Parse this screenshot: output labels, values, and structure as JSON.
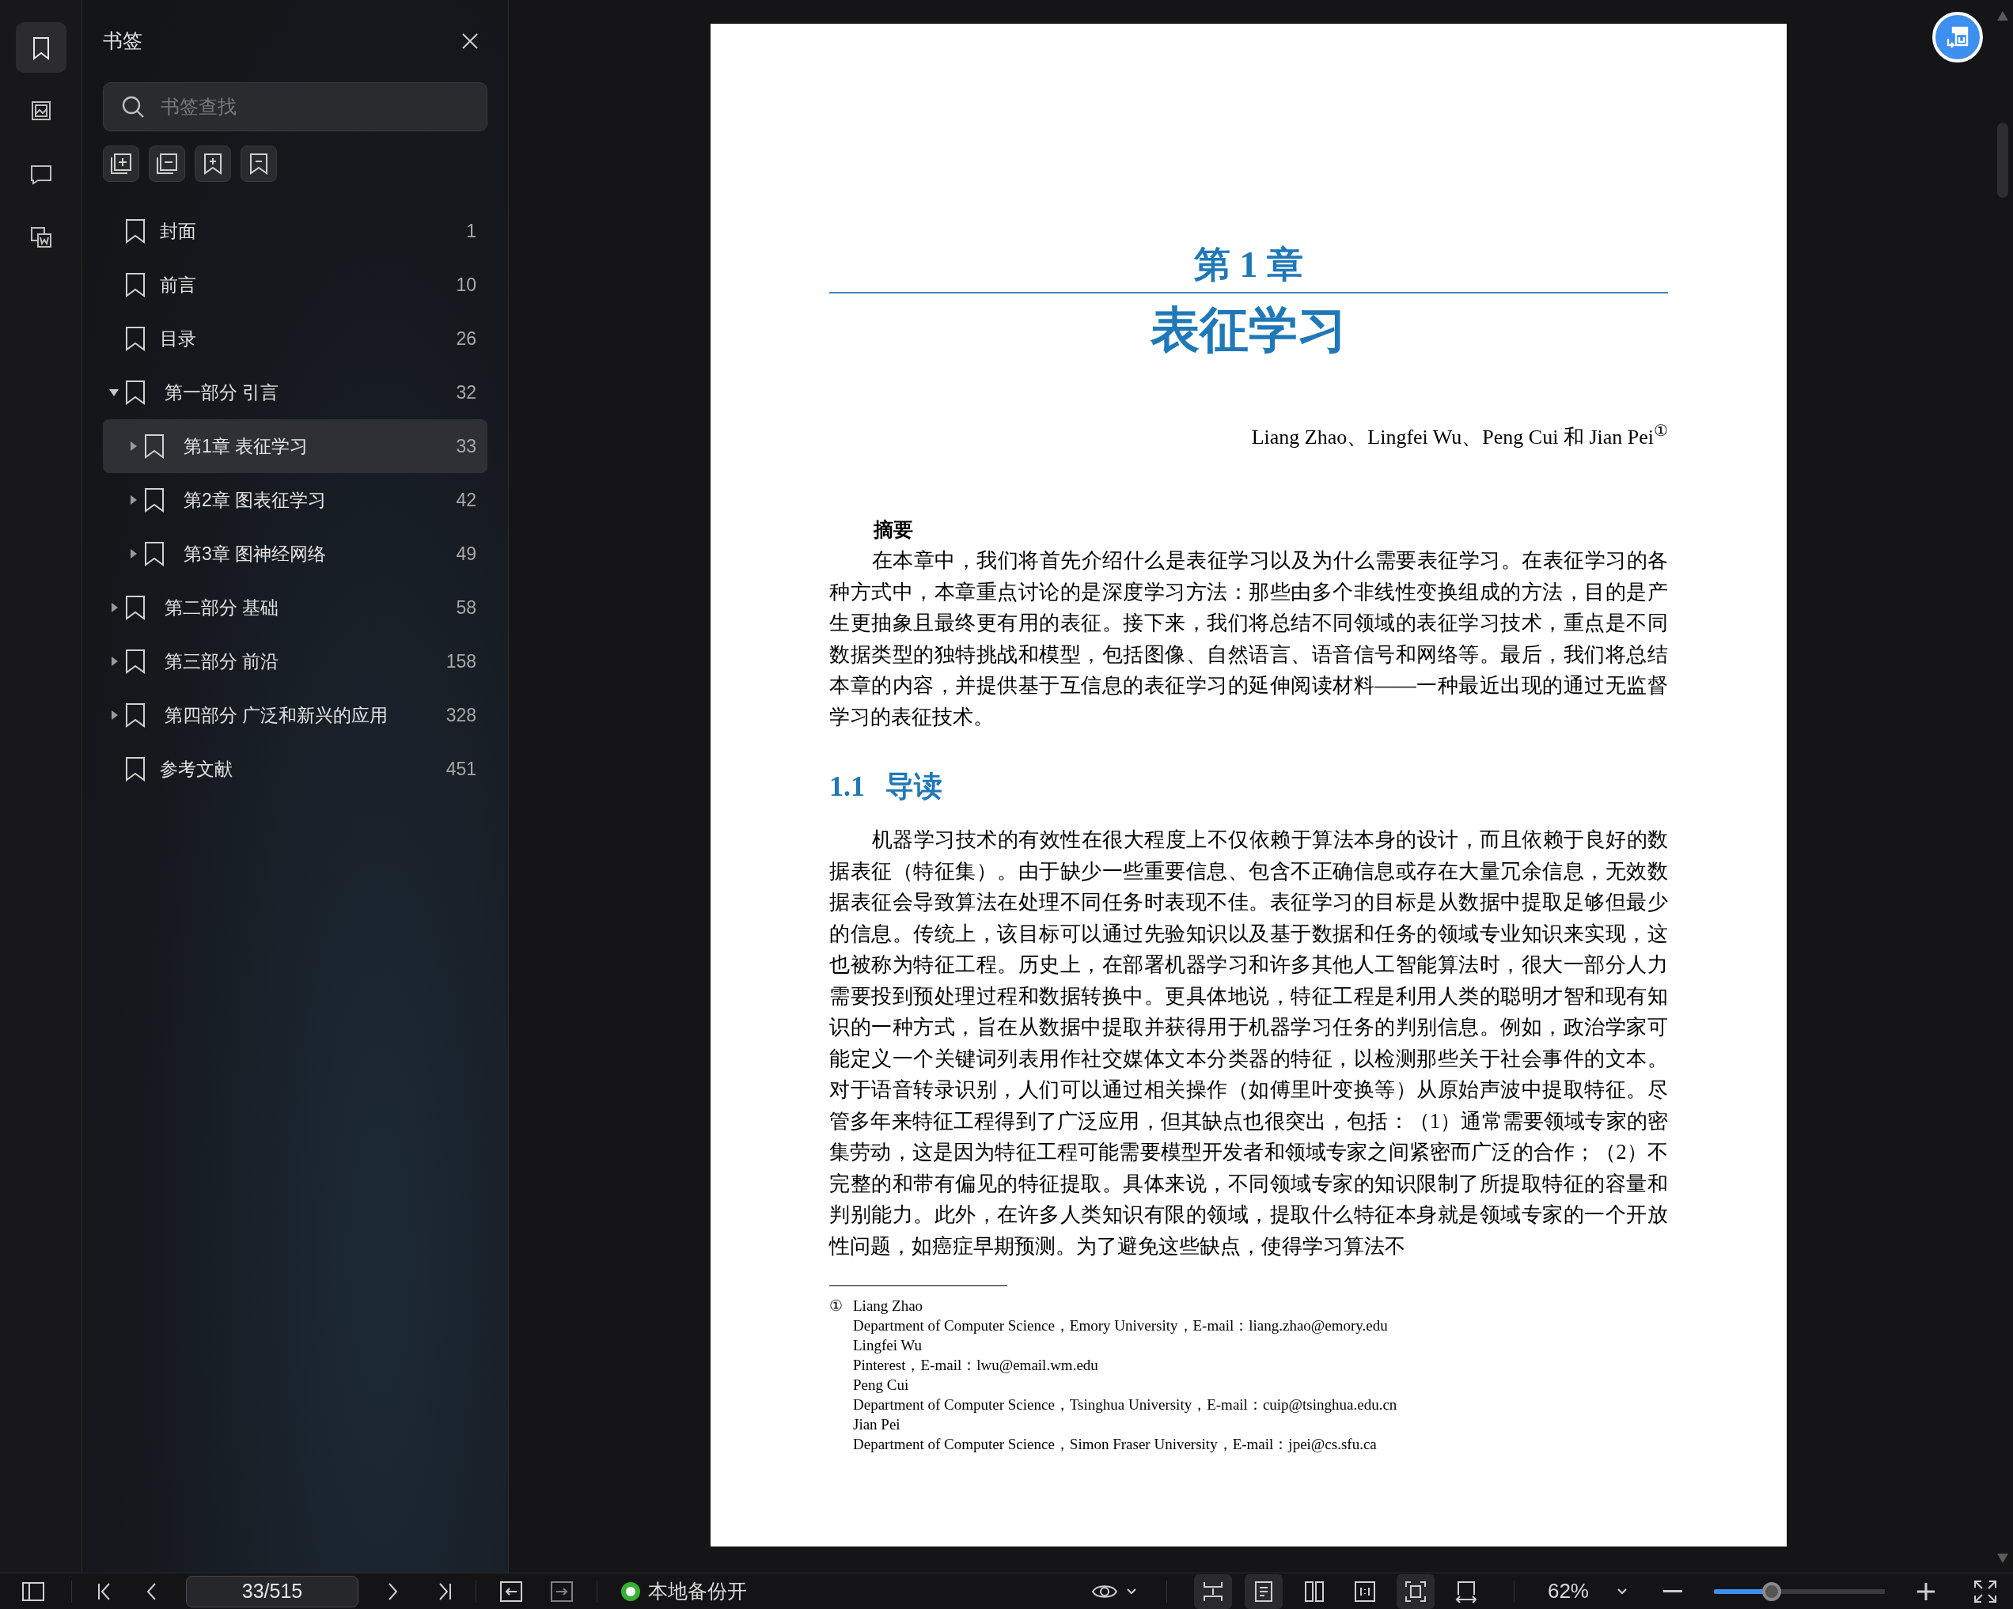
{
  "rail": [
    {
      "selected": true
    },
    {
      "selected": false
    },
    {
      "selected": false
    },
    {
      "selected": false
    }
  ],
  "sidebar": {
    "title": "书签",
    "search": {
      "placeholder": "书签查找"
    },
    "bookmarks": [
      {
        "kind": "leaf",
        "label": "封面",
        "page": "1",
        "selected": false
      },
      {
        "kind": "leaf",
        "label": "前言",
        "page": "10",
        "selected": false
      },
      {
        "kind": "leaf",
        "label": "目录",
        "page": "26",
        "selected": false
      },
      {
        "kind": "group",
        "label": "第一部分 引言",
        "page": "32",
        "selected": false,
        "expanded": true,
        "children": [
          {
            "kind": "group",
            "label": "第1章 表征学习",
            "page": "33",
            "selected": true,
            "expanded": false
          },
          {
            "kind": "group",
            "label": "第2章 图表征学习",
            "page": "42",
            "selected": false,
            "expanded": false
          },
          {
            "kind": "group",
            "label": "第3章 图神经网络",
            "page": "49",
            "selected": false,
            "expanded": false
          }
        ]
      },
      {
        "kind": "group",
        "label": "第二部分 基础",
        "page": "58",
        "selected": false,
        "expanded": false
      },
      {
        "kind": "group",
        "label": "第三部分 前沿",
        "page": "158",
        "selected": false,
        "expanded": false
      },
      {
        "kind": "group",
        "label": "第四部分 广泛和新兴的应用",
        "page": "328",
        "selected": false,
        "expanded": false
      },
      {
        "kind": "leaf",
        "label": "参考文献",
        "page": "451",
        "selected": false
      }
    ]
  },
  "document_page": {
    "chapter_number": "第 1 章",
    "chapter_title": "表征学习",
    "authors": "Liang Zhao、Lingfei Wu、Peng Cui 和 Jian Pei$^{①}$",
    "abstract_heading": "摘要",
    "abstract": "在本章中，我们将首先介绍什么是表征学习以及为什么需要表征学习。在表征学习的各种方式中，本章重点讨论的是深度学习方法：那些由多个非线性变换组成的方法，目的是产生更抽象且最终更有用的表征。接下来，我们将总结不同领域的表征学习技术，重点是不同数据类型的独特挑战和模型，包括图像、自然语言、语音信号和网络等。最后，我们将总结本章的内容，并提供基于互信息的表征学习的延伸阅读材料——一种最近出现的通过无监督学习的表征技术。",
    "section_number": "1.1",
    "section_title": "导读",
    "paragraph": "机器学习技术的有效性在很大程度上不仅依赖于算法本身的设计，而且依赖于良好的数据表征（特征集）。由于缺少一些重要信息、包含不正确信息或存在大量冗余信息，无效数据表征会导致算法在处理不同任务时表现不佳。表征学习的目标是从数据中提取足够但最少的信息。传统上，该目标可以通过先验知识以及基于数据和任务的领域专业知识来实现，这也被称为特征工程。历史上，在部署机器学习和许多其他人工智能算法时，很大一部分人力需要投到预处理过程和数据转换中。更具体地说，特征工程是利用人类的聪明才智和现有知识的一种方式，旨在从数据中提取并获得用于机器学习任务的判别信息。例如，政治学家可能定义一个关键词列表用作社交媒体文本分类器的特征，以检测那些关于社会事件的文本。对于语音转录识别，人们可以通过相关操作（如傅里叶变换等）从原始声波中提取特征。尽管多年来特征工程得到了广泛应用，但其缺点也很突出，包括：（1）通常需要领域专家的密集劳动，这是因为特征工程可能需要模型开发者和领域专家之间紧密而广泛的合作；（2）不完整的和带有偏见的特征提取。具体来说，不同领域专家的知识限制了所提取特征的容量和判别能力。此外，在许多人类知识有限的领域，提取什么特征本身就是领域专家的一个开放性问题，如癌症早期预测。为了避免这些缺点，使得学习算法不",
    "footnote": {
      "marker": "①",
      "lines": [
        "Liang Zhao",
        "Department of Computer Science，Emory University，E-mail：liang.zhao@emory.edu",
        "Lingfei Wu",
        "Pinterest，E-mail：lwu@email.wm.edu",
        "Peng Cui",
        "Department of Computer Science，Tsinghua University，E-mail：cuip@tsinghua.edu.cn",
        "Jian Pei",
        "Department of Computer Science，Simon Fraser University，E-mail：jpei@cs.sfu.ca"
      ]
    }
  },
  "status_bar": {
    "page_field": "33/515",
    "backup": {
      "label": "本地备份开",
      "on": true
    },
    "view_buttons": [
      {
        "selected": true
      },
      {
        "selected": true
      },
      {
        "selected": false
      },
      {
        "selected": false
      },
      {
        "selected": true
      },
      {
        "selected": false
      }
    ],
    "zoom": {
      "label": "62%",
      "level": 0.34
    }
  }
}
